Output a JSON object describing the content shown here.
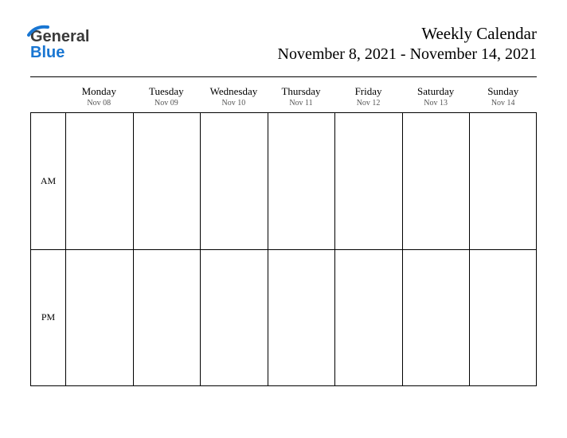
{
  "logo": {
    "part1": "General",
    "part2": "Blue"
  },
  "header": {
    "title": "Weekly Calendar",
    "subtitle": "November 8, 2021 - November 14, 2021"
  },
  "days": [
    {
      "name": "Monday",
      "date": "Nov 08"
    },
    {
      "name": "Tuesday",
      "date": "Nov 09"
    },
    {
      "name": "Wednesday",
      "date": "Nov 10"
    },
    {
      "name": "Thursday",
      "date": "Nov 11"
    },
    {
      "name": "Friday",
      "date": "Nov 12"
    },
    {
      "name": "Saturday",
      "date": "Nov 13"
    },
    {
      "name": "Sunday",
      "date": "Nov 14"
    }
  ],
  "rows": {
    "am": "AM",
    "pm": "PM"
  }
}
